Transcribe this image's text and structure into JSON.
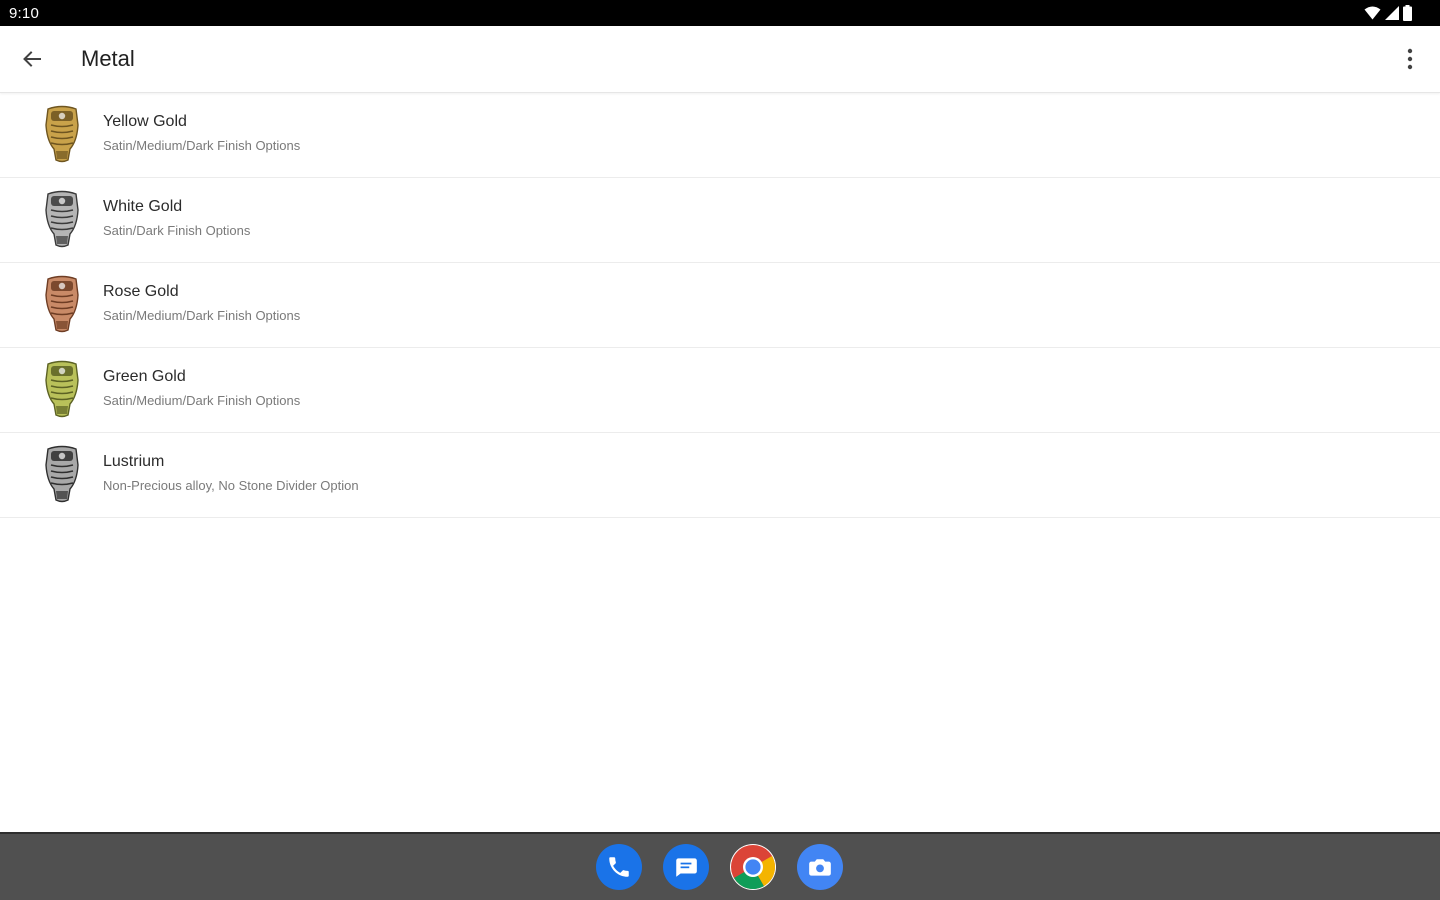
{
  "status_bar": {
    "time": "9:10",
    "icons": [
      "wifi-icon",
      "signal-icon",
      "battery-icon"
    ]
  },
  "app_bar": {
    "title": "Metal",
    "back_icon": "arrow-back-icon",
    "overflow_icon": "more-vert-icon"
  },
  "metals": [
    {
      "name": "Yellow Gold",
      "description": "Satin/Medium/Dark Finish Options",
      "color": "#c9a24a",
      "color_dark": "#6e5520"
    },
    {
      "name": "White Gold",
      "description": "Satin/Dark Finish Options",
      "color": "#b5b5b5",
      "color_dark": "#3a3a3a"
    },
    {
      "name": "Rose Gold",
      "description": "Satin/Medium/Dark Finish Options",
      "color": "#c98a67",
      "color_dark": "#6e3d24"
    },
    {
      "name": "Green Gold",
      "description": "Satin/Medium/Dark Finish Options",
      "color": "#b9c15a",
      "color_dark": "#5c6224"
    },
    {
      "name": "Lustrium",
      "description": "Non-Precious alloy, No Stone Divider Option",
      "color": "#a8a8a8",
      "color_dark": "#2f2f2f"
    }
  ],
  "dock": [
    {
      "name": "phone-app",
      "icon": "phone-icon",
      "color": "#1a73e8"
    },
    {
      "name": "messages-app",
      "icon": "message-icon",
      "color": "#1a73e8"
    },
    {
      "name": "chrome-app",
      "icon": "chrome-icon",
      "color": "#ffffff"
    },
    {
      "name": "camera-app",
      "icon": "camera-icon",
      "color": "#4285f4"
    }
  ],
  "colors": {
    "status_bar": "#000000",
    "nav_bar": "#505050",
    "divider": "#ececec",
    "title_text": "#212121"
  }
}
